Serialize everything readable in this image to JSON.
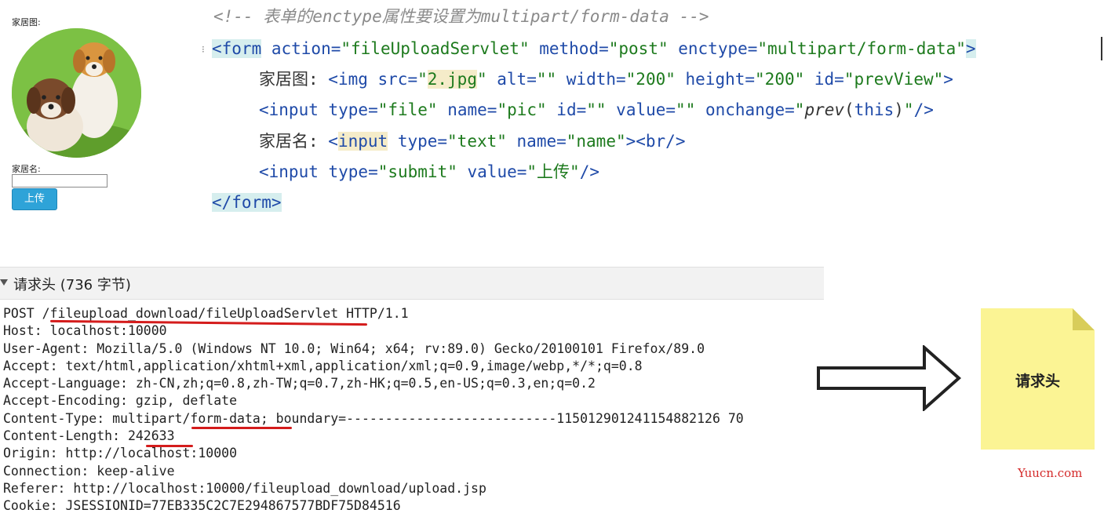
{
  "preview": {
    "image_label": "家居图:",
    "name_label": "家居名:",
    "name_value": "",
    "upload_label": "上传"
  },
  "code": {
    "comment": "<!-- 表单的enctype属性要设置为multipart/form-data -->",
    "form_open_tag": "<form",
    "form_action_attr": " action=",
    "form_action_val": "\"fileUploadServlet\"",
    "form_method_attr": " method=",
    "form_method_val": "\"post\"",
    "form_enctype_attr": " enctype=",
    "form_enctype_val": "\"multipart/form-data\"",
    "form_close_bracket": ">",
    "img_label": "家居图: ",
    "img_tag": "<img",
    "img_src_attr": " src=",
    "img_src_q1": "\"",
    "img_src_val": "2.jpg",
    "img_src_q2": "\"",
    "img_alt_attr": " alt=",
    "img_alt_val": "\"\"",
    "img_width_attr": " width=",
    "img_width_val": "\"200\"",
    "img_height_attr": " height=",
    "img_height_val": "\"200\"",
    "img_id_attr": " id=",
    "img_id_val": "\"prevView\"",
    "img_end": ">",
    "file_tag": "<input",
    "file_type_attr": " type=",
    "file_type_val": "\"file\"",
    "file_name_attr": " name=",
    "file_name_val": "\"pic\"",
    "file_id_attr": " id=",
    "file_id_val": "\"\"",
    "file_value_attr": " value=",
    "file_value_val": "\"\"",
    "file_onchange_attr": " onchange=",
    "file_onchange_q1": "\"",
    "file_onchange_fn": "prev",
    "file_onchange_paren1": "(",
    "file_onchange_arg": "this",
    "file_onchange_paren2": ")",
    "file_onchange_q2": "\"",
    "file_end": "/>",
    "name_label": "家居名: ",
    "name_lt": "<",
    "name_tag": "input",
    "name_type_attr": " type=",
    "name_type_val": "\"text\"",
    "name_name_attr": " name=",
    "name_name_val": "\"name\"",
    "name_end": "><br/>",
    "submit_tag": "<input",
    "submit_type_attr": " type=",
    "submit_type_val": "\"submit\"",
    "submit_value_attr": " value=",
    "submit_value_val": "\"上传\"",
    "submit_end": "/>",
    "form_close": "</form>"
  },
  "request_panel": {
    "title": "请求头 (736 字节)",
    "lines": [
      "POST /fileupload_download/fileUploadServlet HTTP/1.1",
      "Host: localhost:10000",
      "User-Agent: Mozilla/5.0 (Windows NT 10.0; Win64; x64; rv:89.0) Gecko/20100101 Firefox/89.0",
      "Accept: text/html,application/xhtml+xml,application/xml;q=0.9,image/webp,*/*;q=0.8",
      "Accept-Language: zh-CN,zh;q=0.8,zh-TW;q=0.7,zh-HK;q=0.5,en-US;q=0.3,en;q=0.2",
      "Accept-Encoding: gzip, deflate",
      "Content-Type: multipart/form-data; boundary=---------------------------115012901241154882126 70",
      "Content-Length: 242633",
      "Origin: http://localhost:10000",
      "Connection: keep-alive",
      "Referer: http://localhost:10000/fileupload_download/upload.jsp",
      "Cookie: JSESSIONID=77EB335C2C7E294867577BDF75D84516"
    ]
  },
  "note": {
    "text": "请求头"
  },
  "watermark": "Yuucn.com",
  "colors": {
    "tag": "#1f4aa8",
    "value": "#1d7a1d",
    "underline": "#d41c1c",
    "note": "#fbf494",
    "button": "#2ea3d8"
  }
}
